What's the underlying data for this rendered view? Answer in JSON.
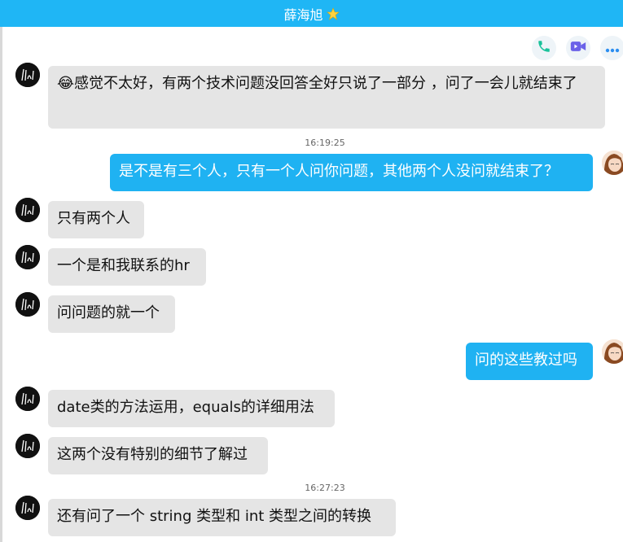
{
  "header": {
    "title": "薛海旭",
    "badge_icon": "star-icon",
    "background": "#1fb6f5"
  },
  "toolbar": {
    "phone_icon": "phone-icon",
    "video_icon": "video-icon",
    "more_icon": "more-icon"
  },
  "colors": {
    "incoming_bubble": "#e5e5e5",
    "outgoing_bubble": "#1fb2f2"
  },
  "messages": [
    {
      "side": "left",
      "text": "😂感觉不太好，有两个技术问题没回答全好只说了一部分 ，问了一会儿就结束了"
    },
    {
      "type": "timestamp",
      "text": "16:19:25"
    },
    {
      "side": "right",
      "text": "是不是有三个人，只有一个人问你问题，其他两个人没问就结束了？"
    },
    {
      "side": "left",
      "text": "只有两个人"
    },
    {
      "side": "left",
      "text": "一个是和我联系的hr"
    },
    {
      "side": "left",
      "text": "问问题的就一个"
    },
    {
      "side": "right",
      "text": "问的这些教过吗"
    },
    {
      "side": "left",
      "text": "date类的方法运用，equals的详细用法"
    },
    {
      "side": "left",
      "text": "这两个没有特别的细节了解过"
    },
    {
      "type": "timestamp",
      "text": "16:27:23"
    },
    {
      "side": "left",
      "text": "还有问了一个 string 类型和 int 类型之间的转换"
    }
  ]
}
